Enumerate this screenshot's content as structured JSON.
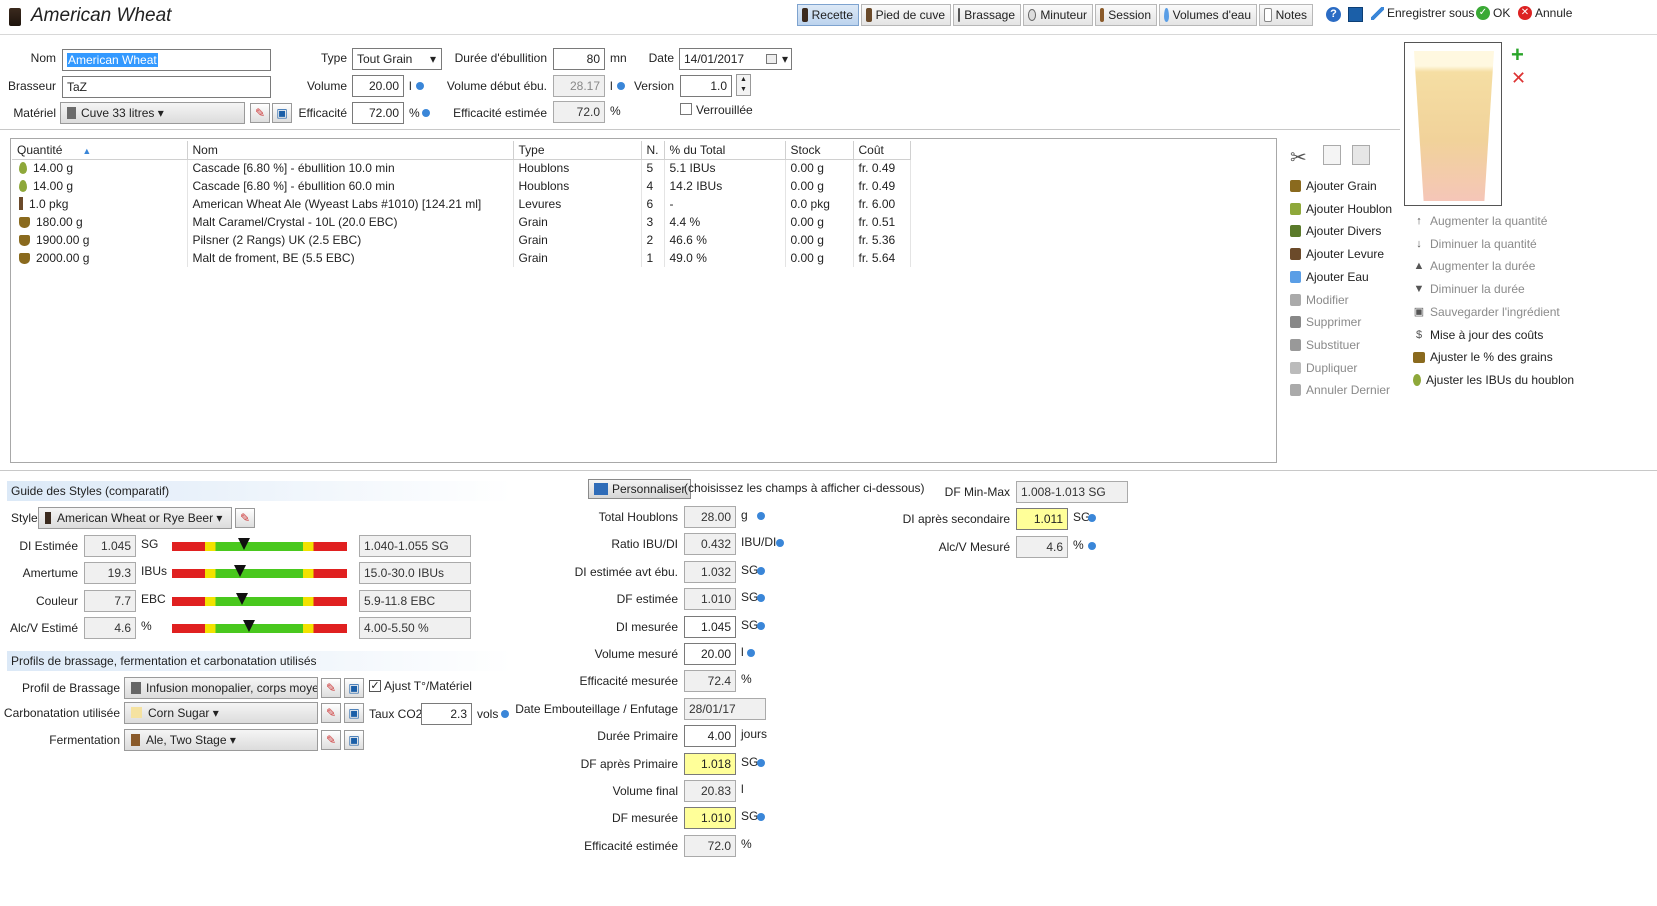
{
  "app": {
    "title": "American Wheat"
  },
  "toolbar": {
    "tabs": [
      {
        "label": "Recette"
      },
      {
        "label": "Pied de cuve"
      },
      {
        "label": "Brassage"
      },
      {
        "label": "Minuteur"
      },
      {
        "label": "Session"
      },
      {
        "label": "Volumes d'eau"
      },
      {
        "label": "Notes"
      }
    ],
    "save_as": "Enregistrer sous",
    "ok": "OK",
    "cancel": "Annule"
  },
  "recipe": {
    "nom_label": "Nom",
    "nom": "American Wheat",
    "brasseur_label": "Brasseur",
    "brasseur": "TaZ",
    "materiel_label": "Matériel",
    "materiel": "Cuve 33 litres",
    "type_label": "Type",
    "type": "Tout Grain",
    "volume_label": "Volume",
    "volume": "20.00",
    "volume_unit": "l",
    "efficacite_label": "Efficacité",
    "efficacite": "72.00",
    "efficacite_unit": "%",
    "duree_label": "Durée d'ébullition",
    "duree": "80",
    "duree_unit": "mn",
    "vol_debut_label": "Volume début ébu.",
    "vol_debut": "28.17",
    "vol_debut_unit": "l",
    "eff_est_label": "Efficacité estimée",
    "eff_est": "72.0",
    "eff_est_unit": "%",
    "date_label": "Date",
    "date": "14/01/2017",
    "version_label": "Version",
    "version": "1.0",
    "verrouillee_label": "Verrouillée"
  },
  "ingredients": {
    "columns": [
      "Quantité",
      "Nom",
      "Type",
      "N.",
      "% du Total",
      "Stock",
      "Coût"
    ],
    "rows": [
      {
        "icon": "hop-icon",
        "qty": "14.00 g",
        "name": "Cascade [6.80 %] - ébullition 10.0 min",
        "type": "Houblons",
        "n": "5",
        "pct": "5.1 IBUs",
        "stock": "0.00 g",
        "cost": "fr. 0.49"
      },
      {
        "icon": "hop-icon",
        "qty": "14.00 g",
        "name": "Cascade [6.80 %] - ébullition 60.0 min",
        "type": "Houblons",
        "n": "4",
        "pct": "14.2 IBUs",
        "stock": "0.00 g",
        "cost": "fr. 0.49"
      },
      {
        "icon": "yeast-icon",
        "qty": "1.0 pkg",
        "name": "American Wheat Ale (Wyeast Labs #1010) [124.21 ml]",
        "type": "Levures",
        "n": "6",
        "pct": "-",
        "stock": "0.0 pkg",
        "cost": "fr. 6.00"
      },
      {
        "icon": "grain-icon",
        "qty": "180.00 g",
        "name": "Malt Caramel/Crystal - 10L (20.0 EBC)",
        "type": "Grain",
        "n": "3",
        "pct": "4.4 %",
        "stock": "0.00 g",
        "cost": "fr. 0.51"
      },
      {
        "icon": "grain-icon",
        "qty": "1900.00 g",
        "name": "Pilsner (2 Rangs) UK (2.5 EBC)",
        "type": "Grain",
        "n": "2",
        "pct": "46.6 %",
        "stock": "0.00 g",
        "cost": "fr. 5.36"
      },
      {
        "icon": "grain-icon",
        "qty": "2000.00 g",
        "name": "Malt de froment, BE (5.5 EBC)",
        "type": "Grain",
        "n": "1",
        "pct": "49.0 %",
        "stock": "0.00 g",
        "cost": "fr. 5.64"
      }
    ]
  },
  "actions_left": [
    "Ajouter Grain",
    "Ajouter Houblon",
    "Ajouter Divers",
    "Ajouter Levure",
    "Ajouter Eau",
    "Modifier",
    "Supprimer",
    "Substituer",
    "Dupliquer",
    "Annuler Dernier"
  ],
  "actions_right": [
    "Augmenter la quantité",
    "Diminuer la quantité",
    "Augmenter la durée",
    "Diminuer la durée",
    "Sauvegarder l'ingrédient",
    "Mise à jour des coûts",
    "Ajuster le % des grains",
    "Ajuster les IBUs du houblon"
  ],
  "styles": {
    "header": "Guide des Styles (comparatif)",
    "style_label": "Style",
    "style": "American Wheat or Rye Beer",
    "rows": [
      {
        "label": "DI Estimée",
        "value": "1.045",
        "unit": "SG",
        "range": "1.040-1.055 SG",
        "level": 0.41
      },
      {
        "label": "Amertume",
        "value": "19.3",
        "unit": "IBUs",
        "range": "15.0-30.0 IBUs",
        "level": 0.39
      },
      {
        "label": "Couleur",
        "value": "7.7",
        "unit": "EBC",
        "range": "5.9-11.8 EBC",
        "level": 0.4
      },
      {
        "label": "Alc/V Estimé",
        "value": "4.6",
        "unit": "%",
        "range": "4.00-5.50 %",
        "level": 0.44
      }
    ]
  },
  "profiles": {
    "header": "Profils de brassage, fermentation et carbonatation utilisés",
    "brassage_label": "Profil de Brassage",
    "brassage": "Infusion monopalier, corps moyen,",
    "ajust_label": "Ajust T°/Matériel",
    "carbo_label": "Carbonatation utilisée",
    "carbo": "Corn Sugar",
    "taux_label": "Taux CO2",
    "taux": "2.3",
    "taux_unit": "vols",
    "ferm_label": "Fermentation",
    "ferm": "Ale, Two Stage"
  },
  "custom": {
    "button": "Personnaliser",
    "hint": "(choisissez les champs à afficher ci-dessous)",
    "fields": [
      {
        "label": "Total Houblons",
        "value": "28.00",
        "unit": "g",
        "style": "ro"
      },
      {
        "label": "Ratio IBU/DI",
        "value": "0.432",
        "unit": "IBU/DI",
        "style": "ro"
      },
      {
        "label": "DI estimée avt ébu.",
        "value": "1.032",
        "unit": "SG",
        "style": "ro"
      },
      {
        "label": "DF estimée",
        "value": "1.010",
        "unit": "SG",
        "style": "ro"
      },
      {
        "label": "DI mesurée",
        "value": "1.045",
        "unit": "SG",
        "style": "w"
      },
      {
        "label": "Volume mesuré",
        "value": "20.00",
        "unit": "l",
        "style": "w"
      },
      {
        "label": "Efficacité mesurée",
        "value": "72.4",
        "unit": "%",
        "style": "ro"
      },
      {
        "label": "Date Embouteillage / Enfutage",
        "value": "28/01/17",
        "unit": "",
        "style": "ro"
      },
      {
        "label": "Durée Primaire",
        "value": "4.00",
        "unit": "jours",
        "style": "w"
      },
      {
        "label": "DF après Primaire",
        "value": "1.018",
        "unit": "SG",
        "style": "yl"
      },
      {
        "label": "Volume final",
        "value": "20.83",
        "unit": "l",
        "style": "ro"
      },
      {
        "label": "DF mesurée",
        "value": "1.010",
        "unit": "SG",
        "style": "yl"
      },
      {
        "label": "Efficacité estimée",
        "value": "72.0",
        "unit": "%",
        "style": "ro"
      }
    ]
  },
  "right_fields": [
    {
      "label": "DF Min-Max",
      "value": "1.008-1.013 SG",
      "unit": "",
      "style": "ro"
    },
    {
      "label": "DI après secondaire",
      "value": "1.011",
      "unit": "SG",
      "style": "yl"
    },
    {
      "label": "Alc/V Mesuré",
      "value": "4.6",
      "unit": "%",
      "style": "ro"
    }
  ],
  "colors": {
    "accent": "#3a86d8",
    "highlight": "#ffff99",
    "beer": "#f3d59a"
  }
}
